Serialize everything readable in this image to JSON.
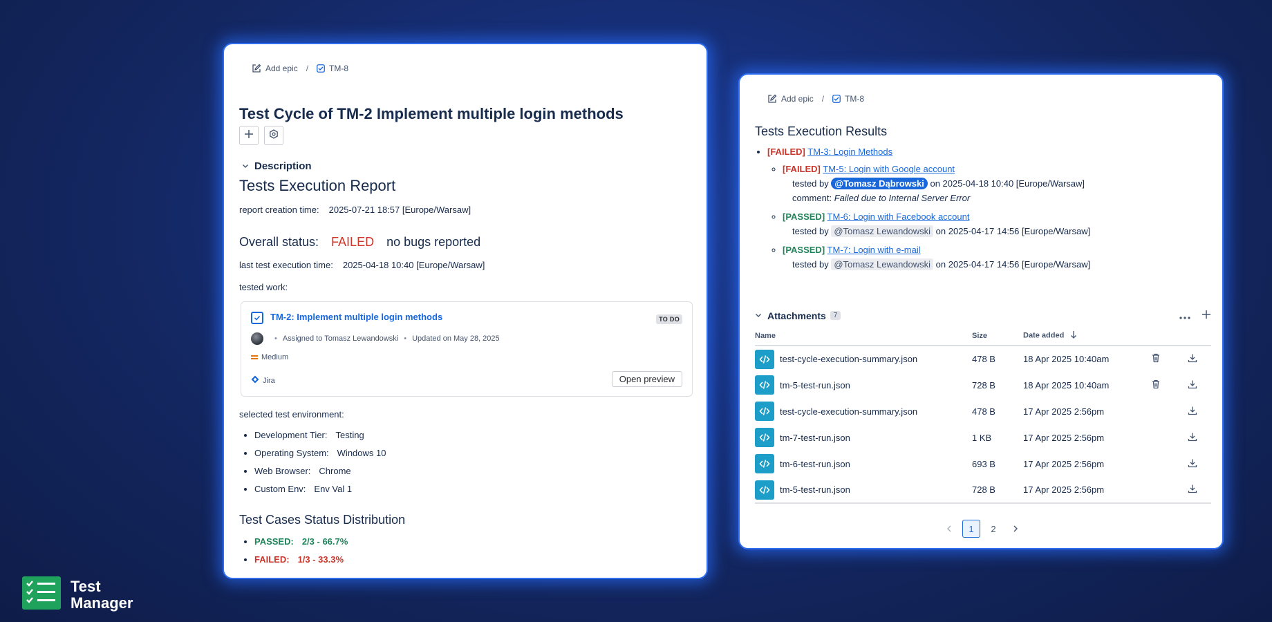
{
  "left": {
    "breadcrumb": {
      "add_epic": "Add epic",
      "separator": "/",
      "issue_key": "TM-8"
    },
    "title": "Test Cycle of TM-2 Implement multiple login methods",
    "description_label": "Description",
    "report_heading": "Tests Execution Report",
    "creation_label": "report creation time:",
    "creation_value": "2025-07-21 18:57 [Europe/Warsaw]",
    "overall_label": "Overall status:",
    "overall_value": "FAILED",
    "bugs_text": "no bugs reported",
    "last_exec_label": "last test execution time:",
    "last_exec_value": "2025-04-18 10:40 [Europe/Warsaw]",
    "tested_work_label": "tested work:",
    "work_card": {
      "link": "TM-2: Implement multiple login methods",
      "status": "TO DO",
      "assigned": "Assigned to Tomasz Lewandowski",
      "updated": "Updated on May 28, 2025",
      "priority": "Medium",
      "source": "Jira",
      "preview_button": "Open preview"
    },
    "env_label": "selected test environment:",
    "environment": [
      {
        "key": "Development Tier:",
        "value": "Testing"
      },
      {
        "key": "Operating System:",
        "value": "Windows 10"
      },
      {
        "key": "Web Browser:",
        "value": "Chrome"
      },
      {
        "key": "Custom Env:",
        "value": "Env Val 1"
      }
    ],
    "distribution_heading": "Test Cases Status Distribution",
    "distribution": {
      "passed_label": "PASSED:",
      "passed_value": "2/3 - 66.7%",
      "failed_label": "FAILED:",
      "failed_value": "1/3 - 33.3%"
    }
  },
  "right": {
    "breadcrumb": {
      "add_epic": "Add epic",
      "separator": "/",
      "issue_key": "TM-8"
    },
    "results_heading": "Tests Execution Results",
    "top": {
      "tag": "[FAILED]",
      "link": "TM-3: Login Methods"
    },
    "items": [
      {
        "tag": "[FAILED]",
        "link": "TM-5: Login with Google account",
        "tested_by": "tested by",
        "user": "@Tomasz Dąbrowski",
        "when": "on 2025-04-18 10:40 [Europe/Warsaw]",
        "comment_label": "comment:",
        "comment": "Failed due to Internal Server Error"
      },
      {
        "tag": "[PASSED]",
        "link": "TM-6: Login with Facebook account",
        "tested_by": "tested by",
        "user": "@Tomasz Lewandowski",
        "when": "on 2025-04-17 14:56 [Europe/Warsaw]"
      },
      {
        "tag": "[PASSED]",
        "link": "TM-7: Login with e-mail",
        "tested_by": "tested by",
        "user": "@Tomasz Lewandowski",
        "when": "on 2025-04-17 14:56 [Europe/Warsaw]"
      }
    ],
    "attachments": {
      "title": "Attachments",
      "count": "7",
      "columns": {
        "name": "Name",
        "size": "Size",
        "date": "Date added"
      },
      "rows": [
        {
          "name": "test-cycle-execution-summary.json",
          "size": "478 B",
          "date": "18 Apr 2025 10:40am",
          "deletable": true
        },
        {
          "name": "tm-5-test-run.json",
          "size": "728 B",
          "date": "18 Apr 2025 10:40am",
          "deletable": true
        },
        {
          "name": "test-cycle-execution-summary.json",
          "size": "478 B",
          "date": "17 Apr 2025 2:56pm",
          "deletable": false
        },
        {
          "name": "tm-7-test-run.json",
          "size": "1 KB",
          "date": "17 Apr 2025 2:56pm",
          "deletable": false
        },
        {
          "name": "tm-6-test-run.json",
          "size": "693 B",
          "date": "17 Apr 2025 2:56pm",
          "deletable": false
        },
        {
          "name": "tm-5-test-run.json",
          "size": "728 B",
          "date": "17 Apr 2025 2:56pm",
          "deletable": false
        }
      ],
      "pages": [
        "1",
        "2"
      ],
      "active_page": "1"
    }
  },
  "brand": {
    "line1": "Test",
    "line2": "Manager",
    "accent": "#1fa35c"
  }
}
